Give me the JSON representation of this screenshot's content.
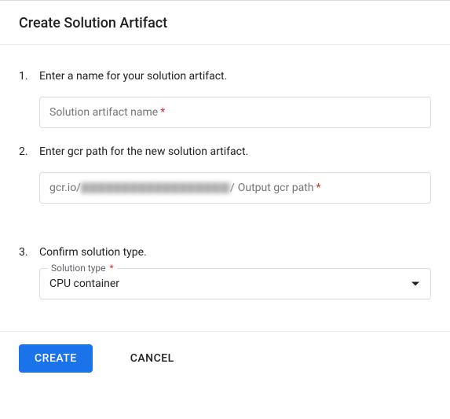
{
  "header": {
    "title": "Create Solution Artifact"
  },
  "steps": {
    "s1": {
      "num": "1.",
      "label": "Enter a name for your solution artifact.",
      "placeholder": "Solution artifact name",
      "req": "*"
    },
    "s2": {
      "num": "2.",
      "label": "Enter gcr path for the new solution artifact.",
      "prefix": "gcr.io/",
      "suffix": "/",
      "placeholder": "Output gcr path",
      "req": "*"
    },
    "s3": {
      "num": "3.",
      "label": "Confirm solution type.",
      "select_label": "Solution type",
      "req": "*",
      "value": "CPU container"
    }
  },
  "footer": {
    "create": "Create",
    "cancel": "Cancel"
  }
}
